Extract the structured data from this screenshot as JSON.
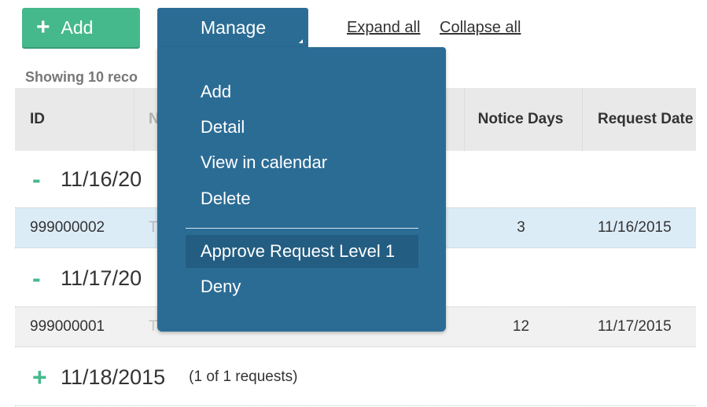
{
  "toolbar": {
    "add_label": "Add",
    "manage_label": "Manage",
    "expand_all": "Expand all",
    "collapse_all": "Collapse all"
  },
  "showing_text": "Showing 10 reco",
  "table": {
    "columns": [
      "ID",
      "N",
      "Notice Days",
      "Request Date"
    ],
    "groups": [
      {
        "sign": "-",
        "date": "11/16/20",
        "rows": [
          {
            "id": "999000002",
            "name_fragment": "T",
            "notice_days": "3",
            "request_date": "11/16/2015"
          }
        ]
      },
      {
        "sign": "-",
        "date": "11/17/20",
        "rows": [
          {
            "id": "999000001",
            "name_fragment": "T",
            "notice_days": "12",
            "request_date": "11/17/2015"
          }
        ]
      },
      {
        "sign": "+",
        "date": "11/18/2015",
        "count": "(1 of 1 requests)"
      }
    ]
  },
  "manage_menu": {
    "items": [
      "Add",
      "Detail",
      "View in calendar",
      "Delete"
    ],
    "items2": [
      "Approve Request Level 1",
      "Deny"
    ]
  },
  "colors": {
    "add_green": "#45b98c",
    "manage_blue": "#2b6c95",
    "selected_row": "#dcecf7"
  }
}
